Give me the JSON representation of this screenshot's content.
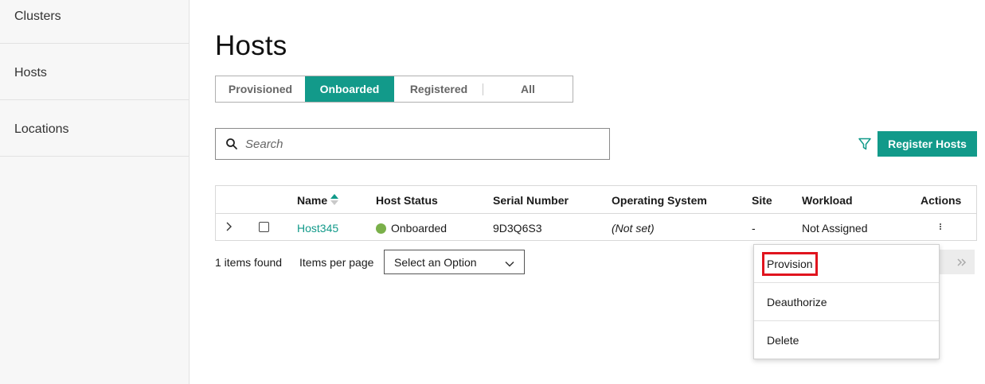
{
  "sidebar": {
    "items": [
      {
        "label": "Clusters"
      },
      {
        "label": "Hosts"
      },
      {
        "label": "Locations"
      }
    ]
  },
  "page": {
    "title": "Hosts"
  },
  "tabs": [
    {
      "label": "Provisioned",
      "active": false
    },
    {
      "label": "Onboarded",
      "active": true
    },
    {
      "label": "Registered",
      "active": false
    },
    {
      "label": "All",
      "active": false
    }
  ],
  "search": {
    "placeholder": "Search",
    "value": ""
  },
  "toolbar": {
    "register_label": "Register Hosts",
    "filter_icon": "filter-icon"
  },
  "table": {
    "columns": [
      "Name",
      "Host Status",
      "Serial Number",
      "Operating System",
      "Site",
      "Workload",
      "Actions"
    ],
    "rows": [
      {
        "name": "Host345",
        "status": "Onboarded",
        "serial": "9D3Q6S3",
        "os": "(Not set)",
        "site": "-",
        "workload": "Not Assigned"
      }
    ]
  },
  "pagination": {
    "items_found": "1 items found",
    "per_page_label": "Items per page",
    "select_placeholder": "Select an Option"
  },
  "action_menu": {
    "items": [
      {
        "label": "Provision",
        "highlighted": true
      },
      {
        "label": "Deauthorize",
        "highlighted": false
      },
      {
        "label": "Delete",
        "highlighted": false
      }
    ]
  },
  "colors": {
    "accent": "#129a8a",
    "status_onboarded": "#7ab04a",
    "highlight_border": "#e0141e"
  }
}
